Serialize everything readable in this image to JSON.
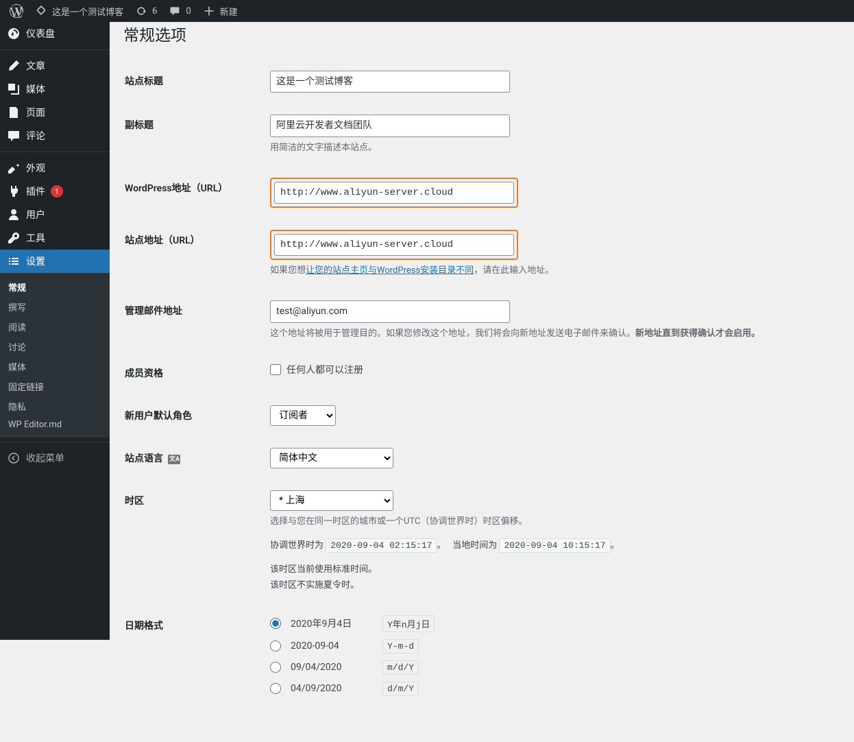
{
  "adminbar": {
    "site_name": "这是一个测试博客",
    "updates": "6",
    "comments": "0",
    "new": "新建"
  },
  "menu": {
    "dashboard": "仪表盘",
    "posts": "文章",
    "media": "媒体",
    "pages": "页面",
    "comments_label": "评论",
    "appearance": "外观",
    "plugins": "插件",
    "plugins_badge": "1",
    "users": "用户",
    "tools": "工具",
    "settings": "设置",
    "sub": {
      "general": "常规",
      "writing": "撰写",
      "reading": "阅读",
      "discussion": "讨论",
      "media": "媒体",
      "permalinks": "固定链接",
      "privacy": "隐私",
      "wpeditor": "WP Editor.md"
    },
    "collapse": "收起菜单"
  },
  "page": {
    "heading": "常规选项"
  },
  "fields": {
    "blogname": {
      "label": "站点标题",
      "value": "这是一个测试博客"
    },
    "blogdesc": {
      "label": "副标题",
      "value": "阿里云开发者文档团队",
      "desc": "用简洁的文字描述本站点。"
    },
    "wpurl": {
      "label": "WordPress地址（URL）",
      "value": "http://www.aliyun-server.cloud"
    },
    "siteurl": {
      "label": "站点地址（URL）",
      "value": "http://www.aliyun-server.cloud",
      "desc_pre": "如果您想",
      "desc_link": "让您的站点主页与WordPress安装目录不同",
      "desc_post": "，请在此输入地址。"
    },
    "admin_email": {
      "label": "管理邮件地址",
      "value": "test@aliyun.com",
      "desc_pre": "这个地址将被用于管理目的。如果您修改这个地址，我们将会向新地址发送电子邮件来确认。",
      "desc_strong": "新地址直到获得确认才会启用。"
    },
    "membership": {
      "label": "成员资格",
      "checkbox": "任何人都可以注册"
    },
    "default_role": {
      "label": "新用户默认角色",
      "value": "订阅者"
    },
    "language": {
      "label": "站点语言",
      "icon_text": "文A",
      "value": "简体中文"
    },
    "timezone": {
      "label": "时区",
      "value": "* 上海",
      "desc": "选择与您在同一时区的城市或一个UTC（协调世界时）时区偏移。",
      "utc_label": "协调世界时为",
      "utc_time": "2020-09-04 02:15:17",
      "local_label": "当地时间为",
      "local_time": "2020-09-04 10:15:17",
      "period": "。",
      "std_time": "该时区当前使用标准时间。",
      "no_dst": "该时区不实施夏令时。"
    },
    "date_format": {
      "label": "日期格式",
      "options": [
        {
          "display": "2020年9月4日",
          "code": "Y年n月j日"
        },
        {
          "display": "2020-09-04",
          "code": "Y-m-d"
        },
        {
          "display": "09/04/2020",
          "code": "m/d/Y"
        },
        {
          "display": "04/09/2020",
          "code": "d/m/Y"
        }
      ]
    }
  }
}
